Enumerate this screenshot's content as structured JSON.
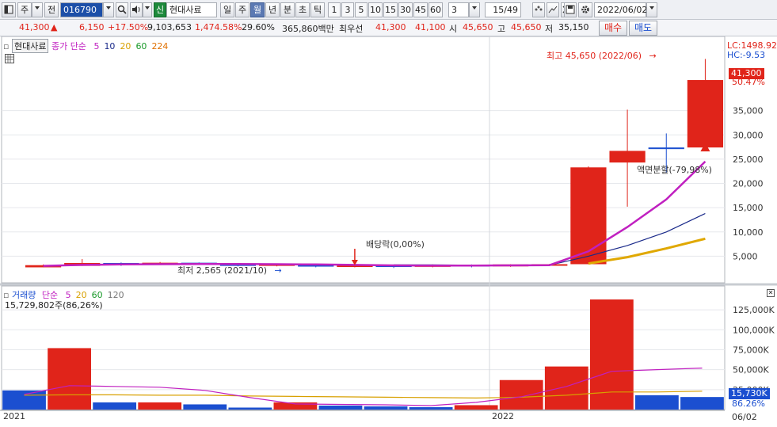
{
  "toolbar": {
    "menu_label": "주",
    "prev_label": "전",
    "code_value": "016790",
    "badge_label": "신",
    "stock_name": "현대사료",
    "periods": [
      "일",
      "주",
      "월",
      "년",
      "분",
      "초",
      "틱"
    ],
    "active_period": "월",
    "intervals": [
      "1",
      "3",
      "5",
      "10",
      "15",
      "30",
      "45",
      "60"
    ],
    "count_value": "3",
    "page_value": "15/49",
    "date_value": "2022/06/02"
  },
  "quote": {
    "price": "41,300",
    "change_arrow": "▲",
    "change": "6,150",
    "change_pct": "+17.50%",
    "volume": "9,103,653",
    "volume_ratio": "1,474.58%",
    "turnover": "29.60%",
    "amount": "365,860백만",
    "best_label": "최우선",
    "best_ask": "41,300",
    "best_bid": "41,100",
    "open_label": "시",
    "open": "45,650",
    "high_label": "고",
    "high": "45,650",
    "low_label": "저",
    "low": "35,150",
    "buy_label": "매수",
    "sell_label": "매도"
  },
  "price_legend": {
    "name": "현대사료",
    "ma_label": "종가 단순",
    "ma": [
      "5",
      "10",
      "20",
      "60",
      "224"
    ],
    "ma_colors": [
      "#c020c0",
      "#1a2a8a",
      "#d8a000",
      "#1a9a2a",
      "#e07000"
    ]
  },
  "vol_legend": {
    "label": "거래량",
    "ma_label": "단순",
    "ma": [
      "5",
      "20",
      "60",
      "120"
    ],
    "ma_colors": [
      "#c020c0",
      "#d8a000",
      "#1a9a2a",
      "#777777"
    ],
    "info": "15,729,802주(86,26%)"
  },
  "annotations": {
    "high_label": "최고 45,650 (2022/06)",
    "high_arrow": "→",
    "low_label": "최저 2,565 (2021/10)",
    "low_arrow": "→",
    "dividend_label": "배당락(0,00%)",
    "split_label": "액면분할(-79,98%)"
  },
  "axis": {
    "lc": "LC:1498.92",
    "hc": "HC:-9.53",
    "price_badge": "41,300",
    "price_badge_pct": "50.47%",
    "price_ticks": [
      "35,000",
      "30,000",
      "25,000",
      "20,000",
      "15,000",
      "10,000",
      "5,000"
    ],
    "vol_ticks": [
      "125,000K",
      "100,000K",
      "75,000K",
      "50,000K",
      "25,000K"
    ],
    "vol_badge": "15,730K",
    "vol_badge_pct": "86.26%",
    "x_labels": [
      "2021",
      "2022"
    ],
    "x_date": "06/02"
  },
  "chart_data": {
    "type": "candlestick",
    "months": [
      "2021/01",
      "2021/02",
      "2021/03",
      "2021/04",
      "2021/05",
      "2021/06",
      "2021/07",
      "2021/08",
      "2021/09",
      "2021/10",
      "2021/11",
      "2021/12",
      "2022/01",
      "2022/02",
      "2022/03",
      "2022/04",
      "2022/05",
      "2022/06"
    ],
    "candles": [
      {
        "o": 2700,
        "h": 3300,
        "l": 2700,
        "c": 3150,
        "dir": "up"
      },
      {
        "o": 3000,
        "h": 4400,
        "l": 3000,
        "c": 3600,
        "dir": "up"
      },
      {
        "o": 3600,
        "h": 3700,
        "l": 3000,
        "c": 3300,
        "dir": "down"
      },
      {
        "o": 3300,
        "h": 3800,
        "l": 3300,
        "c": 3650,
        "dir": "up"
      },
      {
        "o": 3650,
        "h": 3700,
        "l": 3200,
        "c": 3350,
        "dir": "down"
      },
      {
        "o": 3350,
        "h": 3450,
        "l": 2900,
        "c": 3000,
        "dir": "down"
      },
      {
        "o": 3000,
        "h": 3500,
        "l": 2900,
        "c": 3400,
        "dir": "up"
      },
      {
        "o": 3400,
        "h": 3450,
        "l": 2700,
        "c": 2850,
        "dir": "down"
      },
      {
        "o": 2850,
        "h": 3150,
        "l": 2700,
        "c": 3100,
        "dir": "up"
      },
      {
        "o": 3100,
        "h": 3250,
        "l": 2565,
        "c": 2800,
        "dir": "down"
      },
      {
        "o": 2800,
        "h": 3300,
        "l": 2700,
        "c": 3200,
        "dir": "up"
      },
      {
        "o": 3200,
        "h": 3300,
        "l": 2700,
        "c": 2900,
        "dir": "down"
      },
      {
        "o": 2900,
        "h": 3350,
        "l": 2800,
        "c": 3300,
        "dir": "up"
      },
      {
        "o": 3100,
        "h": 3400,
        "l": 3100,
        "c": 3350,
        "dir": "up"
      },
      {
        "o": 3350,
        "h": 23500,
        "l": 3350,
        "c": 23300,
        "dir": "up"
      },
      {
        "o": 24300,
        "h": 35200,
        "l": 15200,
        "c": 26700,
        "dir": "up"
      },
      {
        "o": 27400,
        "h": 30300,
        "l": 22200,
        "c": 27400,
        "dir": "down"
      },
      {
        "o": 27400,
        "h": 45650,
        "l": 27400,
        "c": 41300,
        "dir": "up"
      }
    ],
    "ma5": [
      3000,
      3200,
      3300,
      3350,
      3400,
      3400,
      3350,
      3300,
      3200,
      3100,
      3050,
      3050,
      3100,
      3150,
      6000,
      11000,
      16700,
      24500
    ],
    "ma10": [
      null,
      null,
      null,
      null,
      null,
      null,
      null,
      null,
      null,
      3200,
      3200,
      3150,
      3150,
      3150,
      5000,
      7200,
      10000,
      13800
    ],
    "ma20": [
      null,
      null,
      null,
      null,
      null,
      null,
      null,
      null,
      null,
      null,
      null,
      null,
      null,
      null,
      3500,
      4800,
      6600,
      8600
    ],
    "volume_series": [
      {
        "v": 24000,
        "dir": "down"
      },
      {
        "v": 77000,
        "dir": "up"
      },
      {
        "v": 9000,
        "dir": "down"
      },
      {
        "v": 9000,
        "dir": "up"
      },
      {
        "v": 6500,
        "dir": "down"
      },
      {
        "v": 2500,
        "dir": "down"
      },
      {
        "v": 9000,
        "dir": "up"
      },
      {
        "v": 5000,
        "dir": "down"
      },
      {
        "v": 4000,
        "dir": "down"
      },
      {
        "v": 3000,
        "dir": "down"
      },
      {
        "v": 5500,
        "dir": "up"
      },
      {
        "v": 37000,
        "dir": "up"
      },
      {
        "v": 54000,
        "dir": "up"
      },
      {
        "v": 138000,
        "dir": "up"
      },
      {
        "v": 18000,
        "dir": "down"
      },
      {
        "v": 15730,
        "dir": "down"
      }
    ],
    "vol_ma5": [
      19000,
      30000,
      29000,
      28000,
      24000,
      15000,
      7000,
      6500,
      6000,
      5000,
      9000,
      16000,
      29000,
      48000,
      50000,
      52000
    ],
    "vol_ma20": [
      18000,
      18500,
      18500,
      18000,
      18000,
      17000,
      16500,
      16000,
      15500,
      15000,
      14500,
      15500,
      18000,
      22000,
      22000,
      23000
    ],
    "price_ylim": [
      0,
      48000
    ],
    "volume_ylim": [
      0,
      140000
    ]
  }
}
